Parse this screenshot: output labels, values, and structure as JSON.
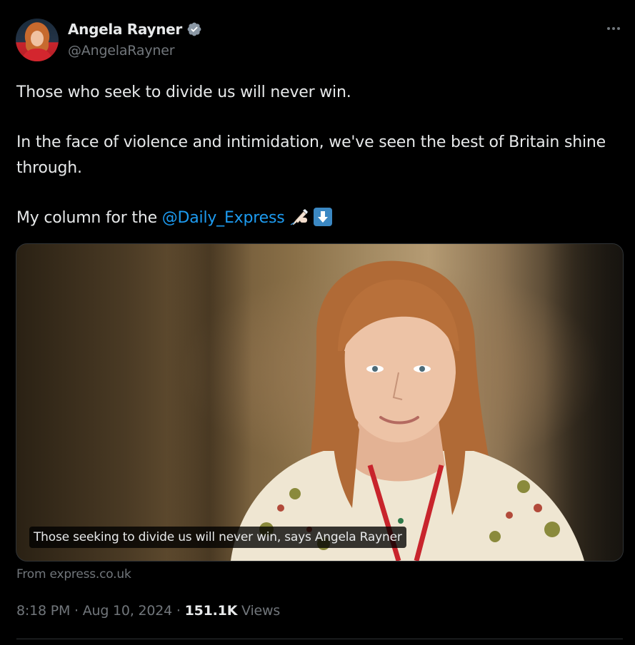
{
  "author": {
    "display_name": "Angela Rayner",
    "handle": "@AngelaRayner",
    "verified": true,
    "verified_color": "#8b98a5"
  },
  "tweet": {
    "line1": "Those who seek to divide us will never win.",
    "line2": "In the face of violence and intimidation, we've seen the best of Britain shine through.",
    "line3_prefix": "My column for the ",
    "line3_mention": "@Daily_Express",
    "emojis": [
      "writing-hand-icon",
      "down-arrow-icon"
    ]
  },
  "card": {
    "caption": "Those seeking to divide us will never win, says Angela Rayner",
    "source": "From express.co.uk"
  },
  "meta": {
    "time": "8:18 PM",
    "separator": " · ",
    "date": "Aug 10, 2024",
    "views_count": "151.1K",
    "views_label": " Views"
  },
  "colors": {
    "background": "#000000",
    "text_primary": "#e7e9ea",
    "text_secondary": "#71767b",
    "link": "#1d9bf0",
    "border": "#2f3336"
  }
}
